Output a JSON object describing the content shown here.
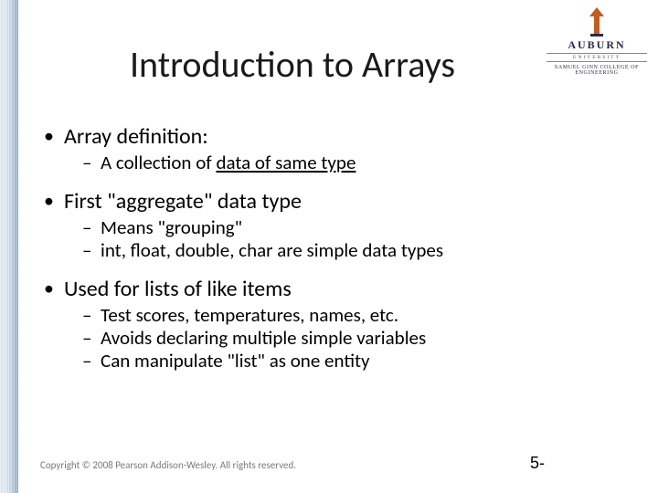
{
  "logo": {
    "name": "AUBURN",
    "sub1": "UNIVERSITY",
    "sub2": "SAMUEL GINN COLLEGE OF ENGINEERING"
  },
  "title": "Introduction to Arrays",
  "bullets": {
    "b1": "Array definition:",
    "b1_1a": "A collection of ",
    "b1_1b": "data of same type",
    "b2": "First \"aggregate\" data type",
    "b2_1": "Means \"grouping\"",
    "b2_2": "int, float, double, char are  simple data types",
    "b3": "Used for lists of like items",
    "b3_1": "Test scores, temperatures, names, etc.",
    "b3_2": "Avoids declaring multiple simple variables",
    "b3_3": "Can manipulate \"list\" as one entity"
  },
  "footer": "Copyright © 2008 Pearson Addison-Wesley. All rights reserved.",
  "page": "5-"
}
